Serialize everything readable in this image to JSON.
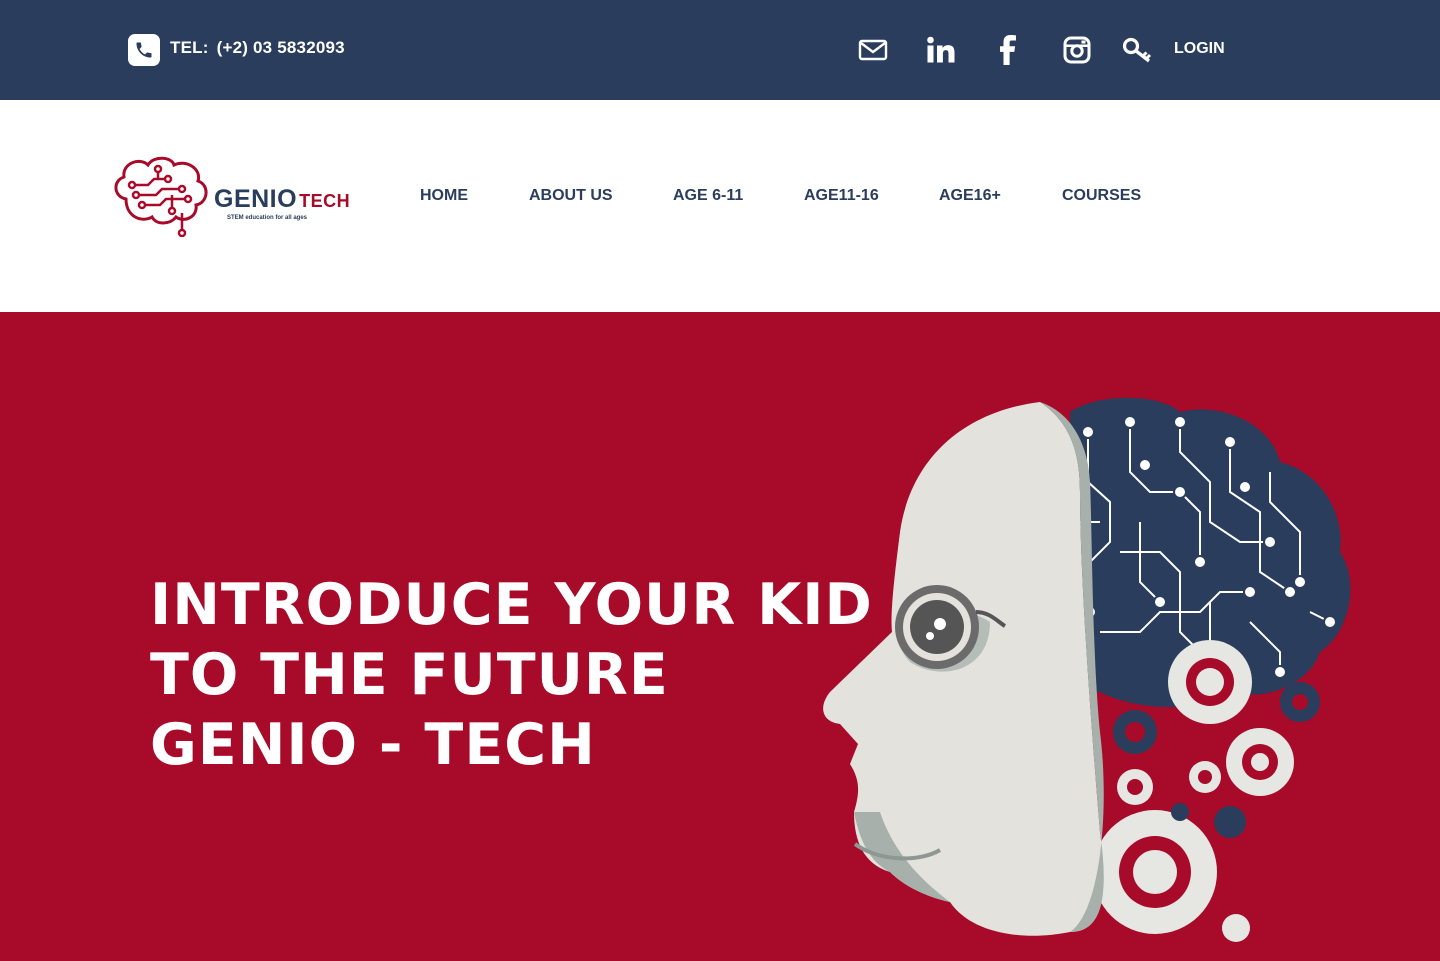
{
  "topbar": {
    "tel_label": "TEL:",
    "tel_number": "(+2) 03 5832093",
    "login_label": "LOGIN",
    "icons": [
      "phone-icon",
      "mail-icon",
      "linkedin-icon",
      "facebook-icon",
      "instagram-icon",
      "key-icon"
    ]
  },
  "logo": {
    "name_main": "GENIO",
    "name_accent": "TECH",
    "tagline": "STEM education for all ages"
  },
  "nav": {
    "items": [
      {
        "label": "HOME"
      },
      {
        "label": "ABOUT US"
      },
      {
        "label": "AGE 6-11"
      },
      {
        "label": "AGE11-16"
      },
      {
        "label": "AGE16+"
      },
      {
        "label": "COURSES"
      }
    ]
  },
  "hero": {
    "line1": "INTRODUCE YOUR KID",
    "line2": "TO THE FUTURE",
    "line3": "GENIO - TECH"
  },
  "colors": {
    "topbar": "#2a3d5c",
    "brand_red": "#a80a29",
    "navy": "#2a3d5c",
    "white": "#ffffff"
  }
}
